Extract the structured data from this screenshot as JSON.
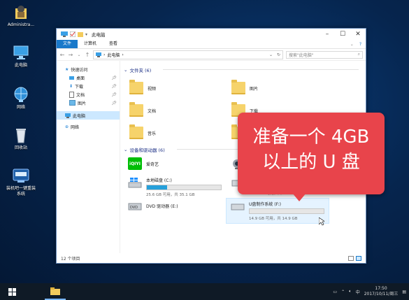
{
  "desktop": {
    "icons": [
      {
        "label": "Administra..."
      },
      {
        "label": "此电脑"
      },
      {
        "label": "网络"
      },
      {
        "label": "回收站"
      },
      {
        "label": "装机吧一键重装系统"
      }
    ]
  },
  "window": {
    "title": "此电脑",
    "ribbon_tabs": [
      "文件",
      "计算机",
      "查看"
    ],
    "address": "此电脑",
    "search_placeholder": "搜索\"此电脑\"",
    "nav": {
      "quick_access": "快速访问",
      "items": [
        {
          "label": "桌面",
          "pinned": true
        },
        {
          "label": "下载",
          "pinned": true
        },
        {
          "label": "文档",
          "pinned": true
        },
        {
          "label": "图片",
          "pinned": true
        }
      ],
      "this_pc": "此电脑",
      "network": "网络"
    },
    "folders_header": "文件夹 (6)",
    "folders": [
      {
        "label": "视频"
      },
      {
        "label": "图片"
      },
      {
        "label": "文档"
      },
      {
        "label": "下载"
      },
      {
        "label": "音乐"
      },
      {
        "label": "桌面"
      }
    ],
    "devices_header": "设备和驱动器 (6)",
    "devices": [
      {
        "label": "爱奇艺"
      },
      {
        "label": "本地磁盘 (C:)",
        "free": "25.6 GB 可用，共 35.1 GB",
        "used_fraction": 0.27
      },
      {
        "label": "DVD 驱动器 (E:)"
      },
      {
        "label": "",
        "free": "13.6 GB 可用，共 14.9 GB",
        "used_fraction": 0.09
      },
      {
        "label": "U盘制作系统 (F:)",
        "free": "14.9 GB 可用，共 14.9 GB",
        "used_fraction": 0.0
      }
    ],
    "status": "12 个项目"
  },
  "callout": {
    "line1": "准备一个 4GB",
    "line2": "以上的 U 盘",
    "color": "#e8444b"
  },
  "taskbar": {
    "time": "17:50",
    "date": "2017/10/11/周三",
    "ime": "中"
  }
}
